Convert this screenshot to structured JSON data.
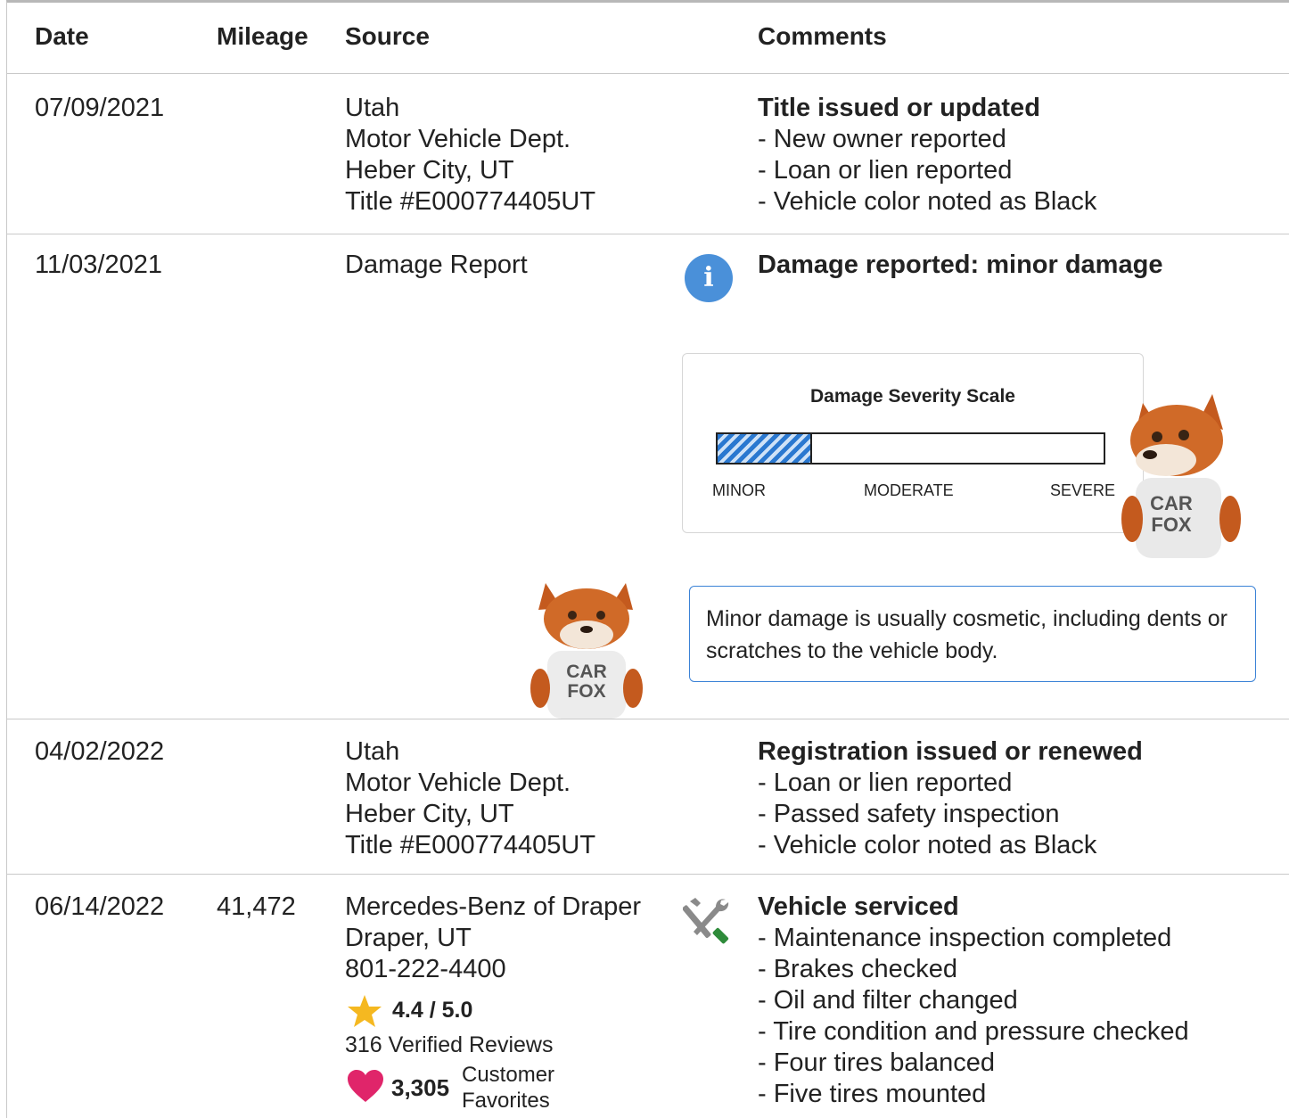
{
  "header": {
    "date": "Date",
    "mileage": "Mileage",
    "source": "Source",
    "comments": "Comments"
  },
  "rows": [
    {
      "date": "07/09/2021",
      "mileage": "",
      "source": [
        "Utah",
        "Motor Vehicle Dept.",
        "Heber City, UT",
        "Title #E000774405UT"
      ],
      "comment_title": "Title issued or updated",
      "comments": [
        "New owner reported",
        "Loan or lien reported",
        "Vehicle color noted as Black"
      ]
    },
    {
      "date": "11/03/2021",
      "mileage": "",
      "source": [
        "Damage Report"
      ],
      "icon": "info-icon",
      "comment_title": "Damage reported: minor damage",
      "severity": {
        "title": "Damage Severity Scale",
        "level_fraction": 0.24,
        "labels": [
          "MINOR",
          "MODERATE",
          "SEVERE"
        ]
      },
      "note": "Minor damage is usually cosmetic, including dents or scratches to the vehicle body.",
      "mascot_text": "CAR FOX"
    },
    {
      "date": "04/02/2022",
      "mileage": "",
      "source": [
        "Utah",
        "Motor Vehicle Dept.",
        "Heber City, UT",
        "Title #E000774405UT"
      ],
      "comment_title": "Registration issued or renewed",
      "comments": [
        "Loan or lien reported",
        "Passed safety inspection",
        "Vehicle color noted as Black"
      ]
    },
    {
      "date": "06/14/2022",
      "mileage": "41,472",
      "source": [
        "Mercedes-Benz of Draper",
        "Draper, UT",
        "801-222-4400"
      ],
      "icon": "wrench-screwdriver-icon",
      "rating": "4.4 / 5.0",
      "reviews": "316 Verified Reviews",
      "favorites_count": "3,305",
      "favorites_label_1": "Customer",
      "favorites_label_2": "Favorites",
      "comment_title": "Vehicle serviced",
      "comments": [
        "Maintenance inspection completed",
        "Brakes checked",
        "Oil and filter changed",
        "Tire condition and pressure checked",
        "Four tires balanced",
        "Five tires mounted"
      ]
    }
  ],
  "colors": {
    "info": "#4a90d9",
    "bar": "#2a78d0",
    "star": "#f5b820",
    "heart": "#e0256a",
    "note_border": "#3b82d6"
  }
}
